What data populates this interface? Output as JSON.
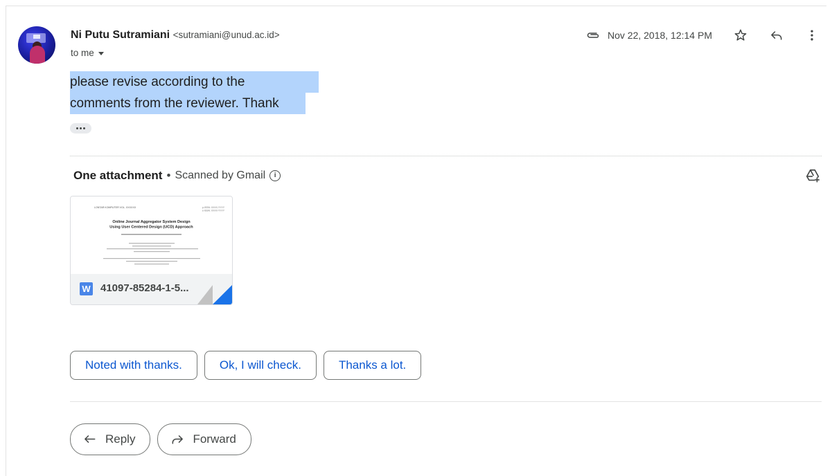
{
  "email": {
    "sender_name": "Ni Putu Sutramiani",
    "sender_email": "<sutramiani@unud.ac.id>",
    "recipient": "to me",
    "date": "Nov 22, 2018, 12:14 PM",
    "body_lines": [
      "please revise according to the",
      "comments from the reviewer. Thank"
    ]
  },
  "attachments": {
    "title": "One attachment",
    "separator": "•",
    "scanned": "Scanned by Gmail",
    "info_glyph": "i",
    "file": {
      "type_letter": "W",
      "name": "41097-85284-1-5...",
      "preview_header_left": "LONTAR KOMPUTER VOL. XXXXXX",
      "preview_header_right_1": "p-ISSN: XXXX-YYYY",
      "preview_header_right_2": "e-ISSN: XXXX-YYYY",
      "preview_title_1": "Online Journal Aggregator System Design",
      "preview_title_2": "Using User Centered Design (UCD) Approach"
    }
  },
  "smart_replies": [
    "Noted with thanks.",
    "Ok, I will check.",
    "Thanks a lot."
  ],
  "actions": {
    "reply": "Reply",
    "forward": "Forward"
  },
  "icons": {
    "attachment": "paperclip-icon",
    "star": "star-icon",
    "reply": "reply-icon",
    "more": "more-vert-icon",
    "drive": "add-to-drive-icon",
    "info": "info-icon"
  },
  "colors": {
    "highlight": "#b3d4fc",
    "link_blue": "#0b57d0",
    "doc_blue": "#4a86e8"
  }
}
